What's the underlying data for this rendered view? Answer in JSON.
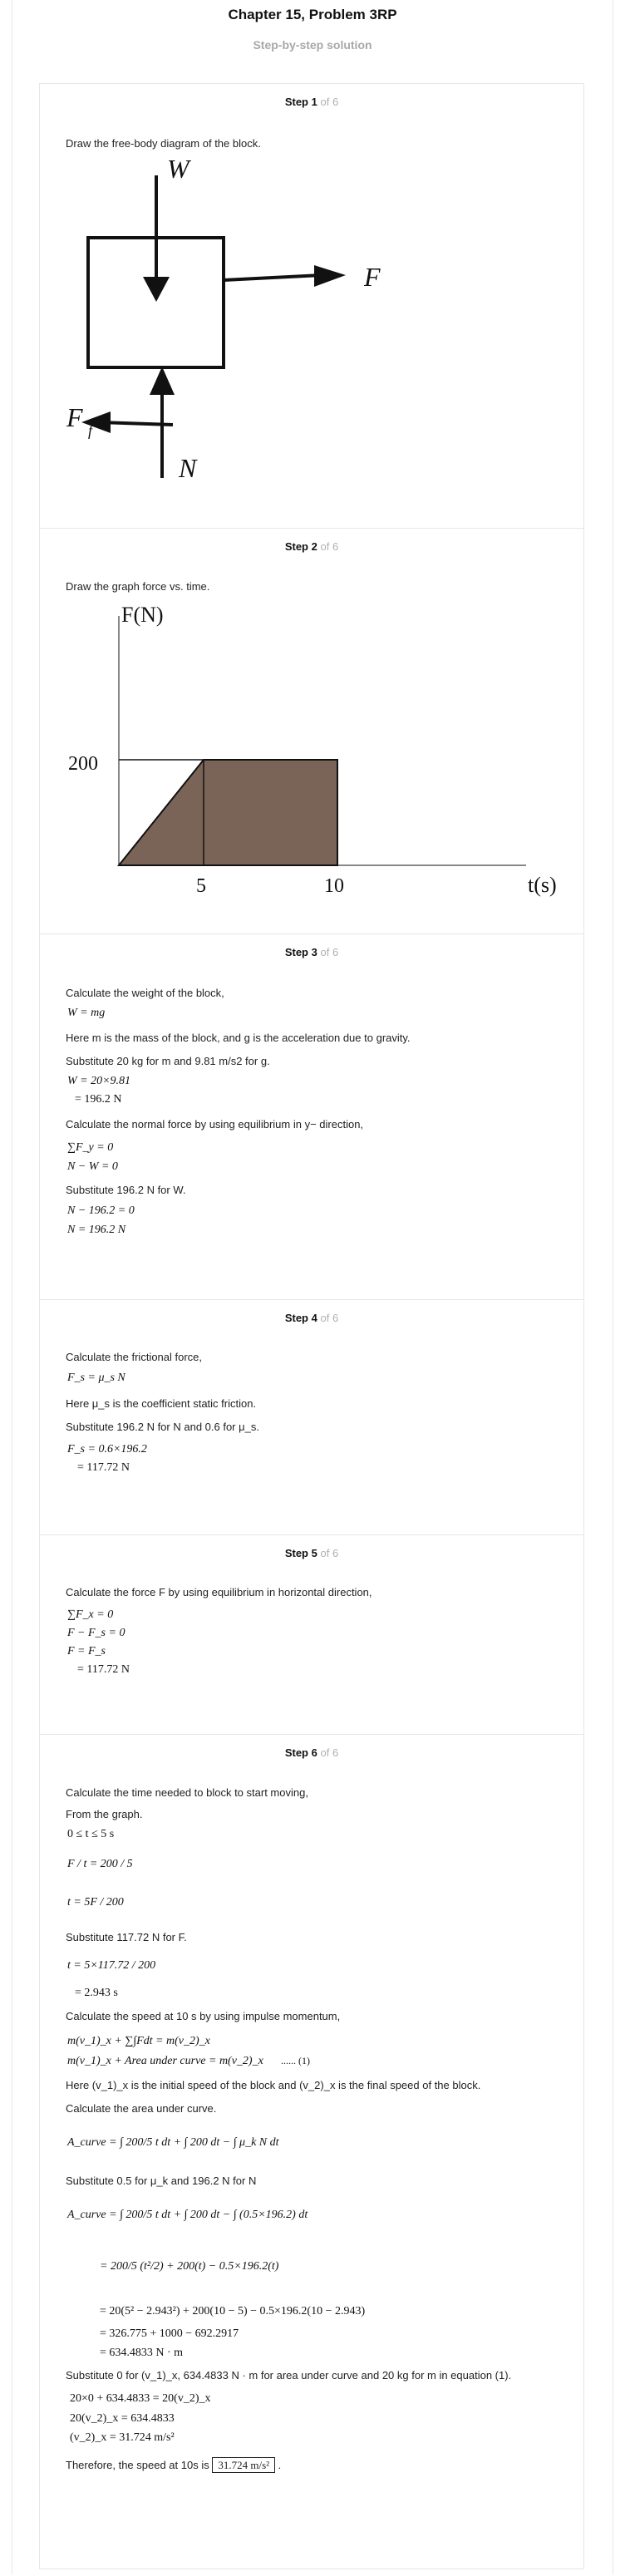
{
  "header": {
    "title": "Chapter 15, Problem 3RP",
    "subtitle": "Step-by-step solution"
  },
  "step_label": "Step",
  "of_label": "of 6",
  "steps": {
    "s1": {
      "num": "1",
      "text": "Draw the free-body diagram of the block.",
      "fbd": {
        "W": "W",
        "F": "F",
        "Ff": "F",
        "Ff_sub": "f",
        "N": "N"
      }
    },
    "s2": {
      "num": "2",
      "text": "Draw the graph force vs. time.",
      "graph": {
        "ylabel": "F(N)",
        "xlabel": "t(s)",
        "y200": "200",
        "x5": "5",
        "x10": "10"
      }
    },
    "s3": {
      "num": "3",
      "l1": "Calculate the weight of the block,",
      "e1": "W = mg",
      "l2": "Here m is the mass of the block, and g is the acceleration due to gravity.",
      "l3": "Substitute 20 kg for m and 9.81 m/s2 for g.",
      "e2": "W = 20×9.81",
      "e3": "= 196.2 N",
      "l4": "Calculate the normal force by using equilibrium in y− direction,",
      "e4": "∑F_y = 0",
      "e5": "N − W = 0",
      "l5": "Substitute 196.2 N for W.",
      "e6": "N − 196.2 = 0",
      "e7": "N = 196.2 N"
    },
    "s4": {
      "num": "4",
      "l1": "Calculate the frictional force,",
      "e1": "F_s = μ_s N",
      "l2": "Here  μ_s is the coefficient static friction.",
      "l3": "Substitute 196.2 N for N and 0.6 for  μ_s.",
      "e2": "F_s = 0.6×196.2",
      "e3": "= 117.72 N"
    },
    "s5": {
      "num": "5",
      "l1": "Calculate the force F by using equilibrium in horizontal direction,",
      "e1": "∑F_x = 0",
      "e2": "F − F_s = 0",
      "e3": "F = F_s",
      "e4": "= 117.72 N"
    },
    "s6": {
      "num": "6",
      "l1": "Calculate the time needed to block to start moving,",
      "l2": "From the graph.",
      "e1": "0 ≤ t ≤ 5 s",
      "e2": "F / t = 200 / 5",
      "e3": "t = 5F / 200",
      "l3": "Substitute 117.72 N for F.",
      "e4": "t = 5×117.72 / 200",
      "e5": "= 2.943 s",
      "l4": "Calculate the speed at 10 s by using impulse momentum,",
      "e6": "m(v_1)_x + ∑∫Fdt = m(v_2)_x",
      "e7": "m(v_1)_x + Area under curve = m(v_2)_x",
      "eq_no": "...... (1)",
      "l5": "Here  (v_1)_x is the initial speed of the block and  (v_2)_x is the final speed of the block.",
      "l6": "Calculate the area under curve.",
      "e8": "A_curve = ∫ 200/5 t dt + ∫ 200 dt − ∫ μ_k N dt",
      "l7": "Substitute 0.5 for  μ_k and  196.2 N for N",
      "e9": "A_curve = ∫ 200/5 t dt + ∫ 200 dt − ∫ (0.5×196.2) dt",
      "e10": "= 200/5 (t²/2) + 200(t) − 0.5×196.2(t)",
      "e11": "= 20(5² − 2.943²) + 200(10 − 5) − 0.5×196.2(10 − 2.943)",
      "e12": "= 326.775 + 1000 − 692.2917",
      "e13": "= 634.4833 N · m",
      "l8": "Substitute 0 for  (v_1)_x,  634.4833 N · m for area under curve and 20 kg for m in equation (1).",
      "e14": "20×0 + 634.4833 = 20(v_2)_x",
      "e15": "20(v_2)_x = 634.4833",
      "e16": "(v_2)_x = 31.724 m/s²",
      "l9": "Therefore, the speed at 10s is",
      "answer": "31.724 m/s²"
    }
  }
}
